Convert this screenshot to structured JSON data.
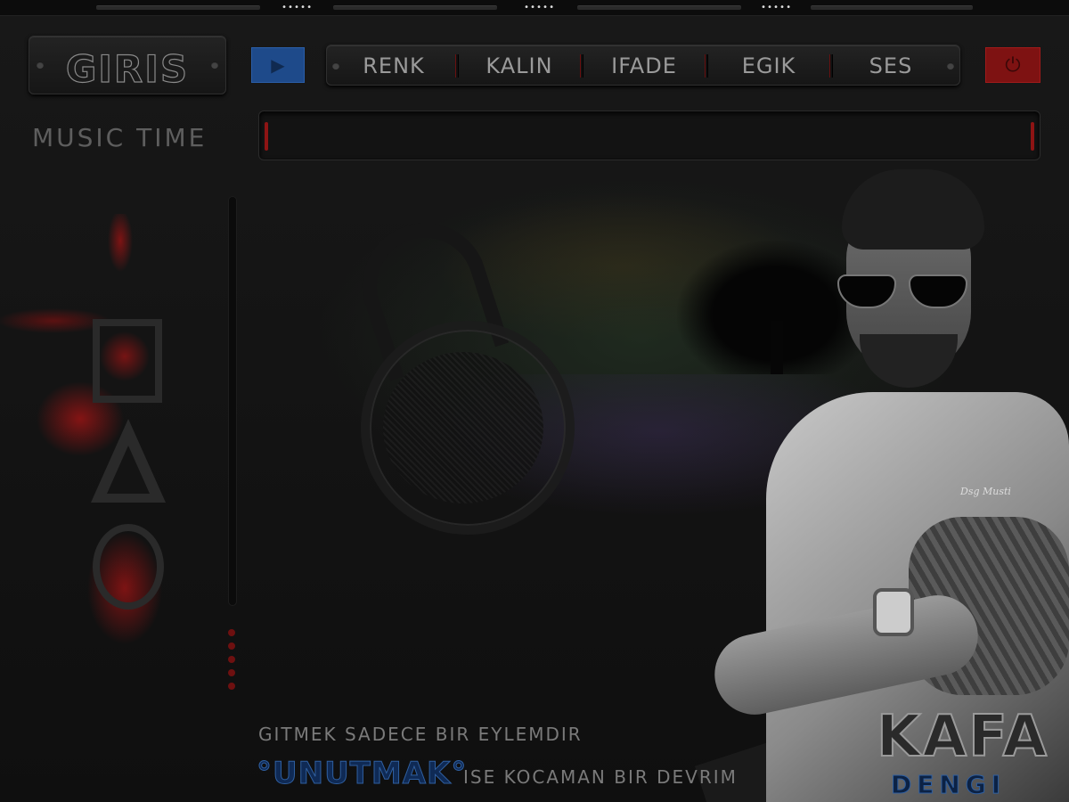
{
  "header": {
    "title": "GIRIS",
    "rail_dots": [
      "•••••",
      "•••••",
      "•••••"
    ]
  },
  "controls": {
    "play_icon": "▶",
    "power_icon": "⏻"
  },
  "menu": {
    "items": [
      {
        "label": "RENK"
      },
      {
        "label": "KALIN"
      },
      {
        "label": "IFADE"
      },
      {
        "label": "EGIK"
      },
      {
        "label": "SES"
      }
    ]
  },
  "music": {
    "label": "MUSIC  TIME"
  },
  "image": {
    "watermark": "Dsg Musti"
  },
  "quote": {
    "line1": "GITMEK SADECE BIR EYLEMDIR",
    "highlight": "°UNUTMAK°",
    "line2": "ISE KOCAMAN BIR DEVRIM"
  },
  "brand": {
    "name": "KAFA",
    "sub": "DENGI"
  },
  "colors": {
    "accent_blue": "#1e4a8a",
    "accent_red": "#7e1212",
    "background": "#111111"
  }
}
